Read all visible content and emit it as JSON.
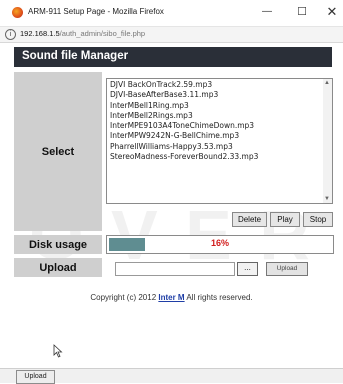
{
  "window": {
    "title": "ARM-911 Setup Page - Mozilla Firefox",
    "min_glyph": "—",
    "max_glyph": "☐",
    "close_glyph": "✕"
  },
  "address": {
    "host": "192.168.1.5",
    "path": "/auth_admin/sibo_file.php",
    "info_glyph": "i"
  },
  "page": {
    "header": "Sound file Manager",
    "watermark": "O V E R"
  },
  "select": {
    "label": "Select",
    "files": [
      "DJVI BackOnTrack2.59.mp3",
      "DJVI-BaseAfterBase3.11.mp3",
      "InterMBell1Ring.mp3",
      "InterMBell2Rings.mp3",
      "InterMPE9103A4ToneChimeDown.mp3",
      "InterMPW9242N-G-BellChime.mp3",
      "PharrellWilliams-Happy3.53.mp3",
      "StereoMadness-ForeverBound2.33.mp3"
    ],
    "buttons": {
      "delete": "Delete",
      "play": "Play",
      "stop": "Stop"
    }
  },
  "disk": {
    "label": "Disk usage",
    "percent_text": "16%",
    "usage_fraction": 0.16
  },
  "upload": {
    "label": "Upload",
    "file_value": "",
    "browse_label": "...",
    "button_label": "Upload"
  },
  "footer": {
    "prefix": "Copyright (c) 2012 ",
    "brand": "Inter M",
    "suffix": " All rights reserved."
  },
  "statusbar": {
    "upload_label": "Upload"
  },
  "colors": {
    "header_bg": "#2a2f38",
    "label_bg": "#cfcfcf",
    "disk_fill": "#5f8d91",
    "percent": "#d21d1d",
    "brand_link": "#1f3ea6"
  }
}
